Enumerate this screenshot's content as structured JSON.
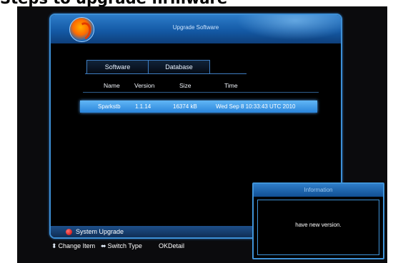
{
  "caption": "Steps to upgrade firmware",
  "dialog": {
    "title": "Upgrade Software",
    "tabs": [
      {
        "label": "Software"
      },
      {
        "label": "Database"
      }
    ],
    "columns": [
      "Name",
      "Version",
      "Size",
      "Time"
    ],
    "rows": [
      {
        "name": "Sparkstb",
        "version": "1.1.14",
        "size": "16374 kB",
        "time": "Wed Sep  8 10:33:43 UTC 2010"
      }
    ],
    "status": {
      "label": "System Upgrade",
      "indicator_color": "#d00000"
    }
  },
  "footer": [
    {
      "icon": "up-down-arrow-icon",
      "label": "Change Item"
    },
    {
      "icon": "left-right-arrow-icon",
      "label": "Switch Type"
    },
    {
      "icon": "ok-icon",
      "label": "OK",
      "label2": "Detail"
    }
  ],
  "popup": {
    "title": "Information",
    "message": "have new version."
  },
  "colors": {
    "accent": "#2a85db",
    "titlebar": "#145aa6",
    "border": "#3d8fd6"
  }
}
